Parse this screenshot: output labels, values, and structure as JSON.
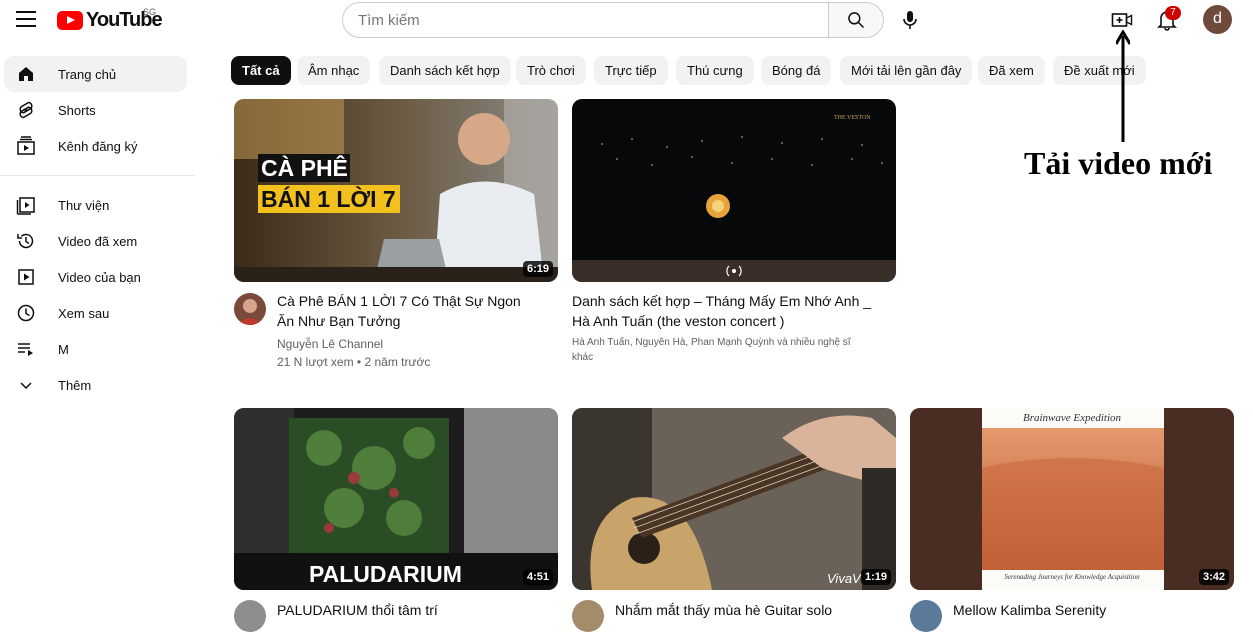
{
  "header": {
    "logo_text": "YouTube",
    "region": "SG",
    "search_placeholder": "Tìm kiếm",
    "notifications_count": "7",
    "user_initial": "d"
  },
  "sidebar": {
    "items": [
      {
        "label": "Trang chủ",
        "icon": "home-icon"
      },
      {
        "label": "Shorts",
        "icon": "shorts-icon"
      },
      {
        "label": "Kênh đăng ký",
        "icon": "subscriptions-icon"
      },
      {
        "label": "Thư viện",
        "icon": "library-icon"
      },
      {
        "label": "Video đã xem",
        "icon": "history-icon"
      },
      {
        "label": "Video của bạn",
        "icon": "your-videos-icon"
      },
      {
        "label": "Xem sau",
        "icon": "watch-later-icon"
      },
      {
        "label": "M",
        "icon": "playlist-icon"
      },
      {
        "label": "Thêm",
        "icon": "chevron-down-icon"
      }
    ]
  },
  "chips": [
    "Tất cả",
    "Âm nhạc",
    "Danh sách kết hợp",
    "Trò chơi",
    "Trực tiếp",
    "Thú cưng",
    "Bóng đá",
    "Mới tải lên gần đây",
    "Đã xem",
    "Đề xuất mới"
  ],
  "videos": [
    {
      "title_line1": "Cà Phê BÁN 1 LỜI 7 Có Thật Sự Ngon",
      "title_line2": "Ăn Như Bạn Tưởng",
      "channel": "Nguyễn Lê Channel",
      "stats": "21 N lượt xem • 2 năm trước",
      "duration": "6:19",
      "thumb_text_1": "CÀ PHÊ",
      "thumb_text_2": "BÁN 1 LỜI 7"
    },
    {
      "title_line1": "Danh sách kết hợp – Tháng Mấy Em Nhớ Anh _",
      "title_line2": "Hà Anh Tuấn (the veston concert )",
      "artists_line1": "Hà Anh Tuấn, Nguyên Hà, Phan Mạnh Quỳnh và nhiều nghệ sĩ",
      "artists_line2": "khác"
    },
    {
      "title_line1": "PALUDARIUM thổi tâm trí",
      "duration": "4:51",
      "thumb_text": "PALUDARIUM"
    },
    {
      "title_line1": "Nhắm mắt thấy mùa hè Guitar solo",
      "duration": "1:19",
      "thumb_watermark": "VivaV"
    },
    {
      "title_line1": "Mellow Kalimba Serenity",
      "duration": "3:42",
      "thumb_top_text": "Brainwave Expedition",
      "thumb_bottom_text": "Serenading Journeys for Knowledge Acquisition"
    }
  ],
  "annotation": {
    "label": "Tải video mới"
  },
  "colors": {
    "brand_red": "#ff0000",
    "chip_bg": "#f2f2f2",
    "text_secondary": "#606060"
  }
}
